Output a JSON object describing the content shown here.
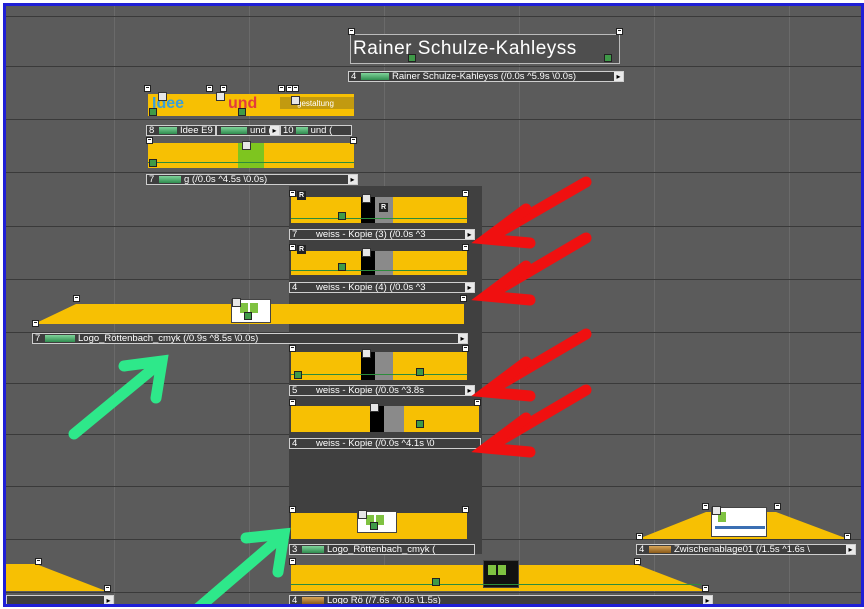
{
  "app": {
    "frame_color": "#1f1fd6",
    "bar_color": "#f7c003",
    "arrow_red": "#f01010",
    "arrow_green": "#2ee88a"
  },
  "clips": {
    "title": {
      "track": "4",
      "label": "Rainer Schulze-Kahleyss (/0.0s ^5.9s \\0.0s)",
      "overlay_text": "Rainer Schulze-Kahleyss"
    },
    "idee": {
      "track": "8",
      "label": "Idee E9",
      "overlay_text": "Idee"
    },
    "und": {
      "label": "und (",
      "overlay_text": "und"
    },
    "und2": {
      "track": "10",
      "label": "und (",
      "overlay_text": "gestaltung"
    },
    "g": {
      "track": "7",
      "label": "g (/0.0s ^4.5s \\0.0s)"
    },
    "weiss3": {
      "track": "7",
      "label": "weiss - Kopie (3) (/0.0s ^3"
    },
    "weiss4": {
      "track": "4",
      "label": "weiss - Kopie (4) (/0.0s ^3"
    },
    "logo_big": {
      "track": "7",
      "label": "Logo_Röttenbach_cmyk (/0.9s ^8.5s \\0.0s)"
    },
    "weissA": {
      "track": "5",
      "label": "weiss - Kopie (/0.0s ^3.8s"
    },
    "weissB": {
      "track": "4",
      "label": "weiss - Kopie (/0.0s ^4.1s \\0"
    },
    "logo_small": {
      "track": "3",
      "label": "Logo_Röttenbach_cmyk ("
    },
    "zwischen": {
      "track": "4",
      "label": "Zwischenablage01 (/1.5s ^1.6s \\"
    },
    "logo_ro": {
      "track": "4",
      "label": "Logo Rö (/7.6s ^0.0s \\1.5s)"
    }
  },
  "icons": {
    "end_marker": "triangle-right-icon",
    "handle": "pin-handle-icon",
    "r_marker": "R"
  }
}
